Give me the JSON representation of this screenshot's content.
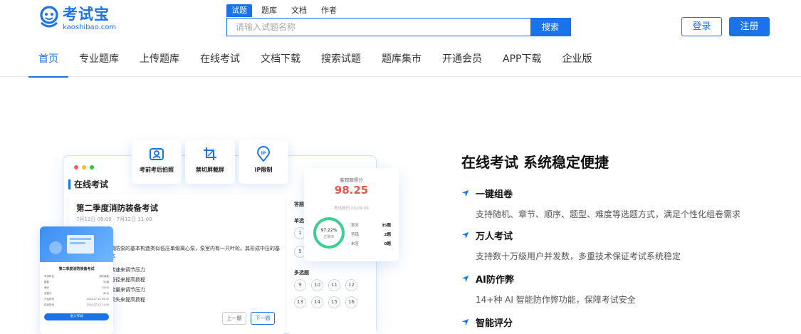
{
  "brand": {
    "name_cn": "考试宝",
    "domain": "kaoshibao.com",
    "color": "#1a73e8"
  },
  "search": {
    "tabs": [
      "试题",
      "题库",
      "文档",
      "作者"
    ],
    "active_tab": "试题",
    "placeholder": "请输入试题名称",
    "button": "搜索"
  },
  "auth": {
    "login": "登录",
    "register": "注册"
  },
  "nav": {
    "items": [
      "首页",
      "专业题库",
      "上传题库",
      "在线考试",
      "文档下载",
      "搜索试题",
      "题库集市",
      "开通会员",
      "APP下载",
      "企业版"
    ],
    "active": "首页"
  },
  "illustration": {
    "window_title": "在线考试",
    "features": [
      {
        "label": "考前考后拍照",
        "icon": "camera-user-icon"
      },
      {
        "label": "禁切屏截屏",
        "icon": "crop-icon"
      },
      {
        "label": "IP限制",
        "icon": "ip-location-icon"
      }
    ],
    "exam": {
      "name": "第二季度消防装备考试",
      "time": "7月12日 09:00 - 7月12日 11:00",
      "question": "消防泵的基本构造类似低压单级离心泵，泵室内有一只叶轮。其形成中压的基本",
      "options": [
        "转速来调节压力",
        "直径来提高扬程",
        "流量来调节压力",
        "损失来提高扬程"
      ],
      "prev": "上一题",
      "next": "下一题"
    },
    "answer_card": {
      "label": "答题",
      "single_label": "单选",
      "single_numbers": [
        "1",
        "3",
        "5"
      ],
      "multi_label": "多选题",
      "multi_numbers": [
        "9",
        "10",
        "11",
        "12",
        "13",
        "14",
        "15",
        "16"
      ]
    },
    "score": {
      "title": "客观题得分",
      "value": "98.25",
      "sub": "考试用时 00:09:09",
      "rate": "97.22%",
      "rate_label": "正确率",
      "stats": [
        {
          "label": "答对",
          "value": "35题"
        },
        {
          "label": "答错",
          "value": "2题"
        },
        {
          "label": "未答",
          "value": "0题"
        }
      ]
    },
    "phone": {
      "title": "第二季度消防装备考试",
      "rows": [
        {
          "k": "考试科目",
          "v": "消防装备"
        },
        {
          "k": "题数",
          "v": "50道"
        },
        {
          "k": "满分",
          "v": "100分"
        },
        {
          "k": "及格分",
          "v": "60分"
        },
        {
          "k": "开始时间",
          "v": "2024-07-12 09:00"
        },
        {
          "k": "结束时间",
          "v": "2024-07-12 11:00"
        }
      ],
      "button": "进入考试"
    }
  },
  "hero": {
    "title": "在线考试 系统稳定便捷",
    "features": [
      {
        "title": "一键组卷",
        "desc": "支持随机、章节、顺序、题型、难度等选题方式，满足个性化组卷需求"
      },
      {
        "title": "万人考试",
        "desc": "支持数十万级用户并发数，多重技术保证考试系统稳定"
      },
      {
        "title": "AI防作弊",
        "desc": "14+种 AI 智能防作弊功能，保障考试安全"
      },
      {
        "title": "智能评分",
        "desc": ""
      }
    ]
  }
}
